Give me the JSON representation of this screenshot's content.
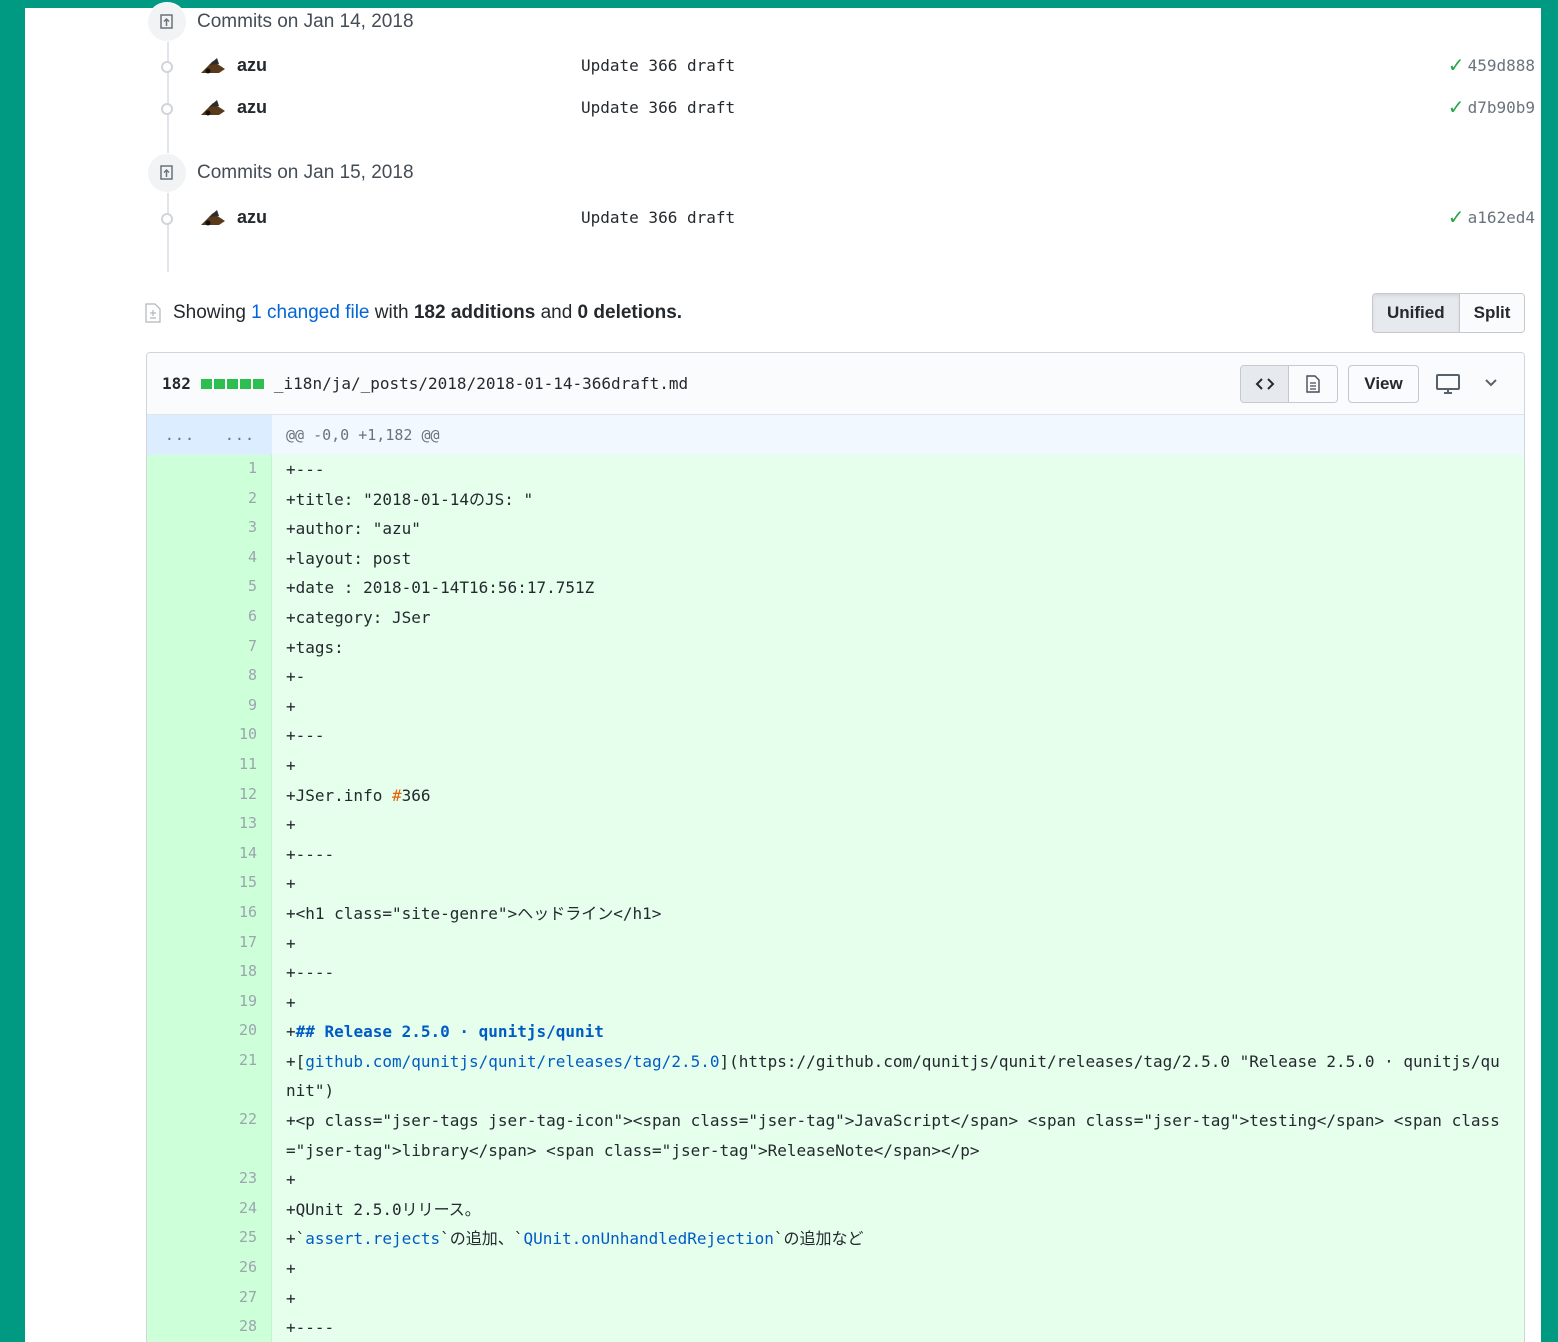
{
  "commit_groups": [
    {
      "title": "Commits on Jan 14, 2018",
      "commits": [
        {
          "author": "azu",
          "message": "Update 366 draft",
          "sha": "459d888"
        },
        {
          "author": "azu",
          "message": "Update 366 draft",
          "sha": "d7b90b9"
        }
      ]
    },
    {
      "title": "Commits on Jan 15, 2018",
      "commits": [
        {
          "author": "azu",
          "message": "Update 366 draft",
          "sha": "a162ed4"
        }
      ]
    }
  ],
  "summary": {
    "prefix": "Showing",
    "link": "1 changed file",
    "with": "with",
    "additions": "182 additions",
    "and": "and",
    "deletions": "0 deletions",
    "suffix": "."
  },
  "view_toggle": {
    "unified": "Unified",
    "split": "Split"
  },
  "file": {
    "diffstat": "182",
    "path": "_i18n/ja/_posts/2018/2018-01-14-366draft.md",
    "view_label": "View",
    "hunk_left": "...",
    "hunk_right": "...",
    "hunk_header": "@@ -0,0 +1,182 @@"
  },
  "diff_lines": [
    {
      "n": "1",
      "text": "+---"
    },
    {
      "n": "2",
      "text": "+title: \"2018-01-14のJS: \""
    },
    {
      "n": "3",
      "text": "+author: \"azu\""
    },
    {
      "n": "4",
      "text": "+layout: post"
    },
    {
      "n": "5",
      "text": "+date : 2018-01-14T16:56:17.751Z"
    },
    {
      "n": "6",
      "text": "+category: JSer"
    },
    {
      "n": "7",
      "text": "+tags:"
    },
    {
      "n": "8",
      "text": "+-"
    },
    {
      "n": "9",
      "text": "+"
    },
    {
      "n": "10",
      "text": "+---"
    },
    {
      "n": "11",
      "text": "+"
    },
    {
      "n": "12",
      "text": "+JSer.info #366"
    },
    {
      "n": "13",
      "text": "+"
    },
    {
      "n": "14",
      "text": "+----"
    },
    {
      "n": "15",
      "text": "+"
    },
    {
      "n": "16",
      "text": "+<h1 class=\"site-genre\">ヘッドライン</h1>"
    },
    {
      "n": "17",
      "text": "+"
    },
    {
      "n": "18",
      "text": "+----"
    },
    {
      "n": "19",
      "text": "+"
    },
    {
      "n": "20",
      "text": "+## Release 2.5.0 · qunitjs/qunit"
    },
    {
      "n": "21",
      "text": "+[github.com/qunitjs/qunit/releases/tag/2.5.0](https://github.com/qunitjs/qunit/releases/tag/2.5.0 \"Release 2.5.0 · qunitjs/qunit\")"
    },
    {
      "n": "22",
      "text": "+<p class=\"jser-tags jser-tag-icon\"><span class=\"jser-tag\">JavaScript</span> <span class=\"jser-tag\">testing</span> <span class=\"jser-tag\">library</span> <span class=\"jser-tag\">ReleaseNote</span></p>"
    },
    {
      "n": "23",
      "text": "+"
    },
    {
      "n": "24",
      "text": "+QUnit 2.5.0リリース。"
    },
    {
      "n": "25",
      "text": "+`assert.rejects`の追加、`QUnit.onUnhandledRejection`の追加など"
    },
    {
      "n": "26",
      "text": "+"
    },
    {
      "n": "27",
      "text": "+"
    },
    {
      "n": "28",
      "text": "+----"
    }
  ],
  "colors": {
    "frame": "#009982",
    "addition_bg": "#e6ffed",
    "addition_gutter": "#cdffd8",
    "link": "#0366d6",
    "check": "#28a745"
  }
}
